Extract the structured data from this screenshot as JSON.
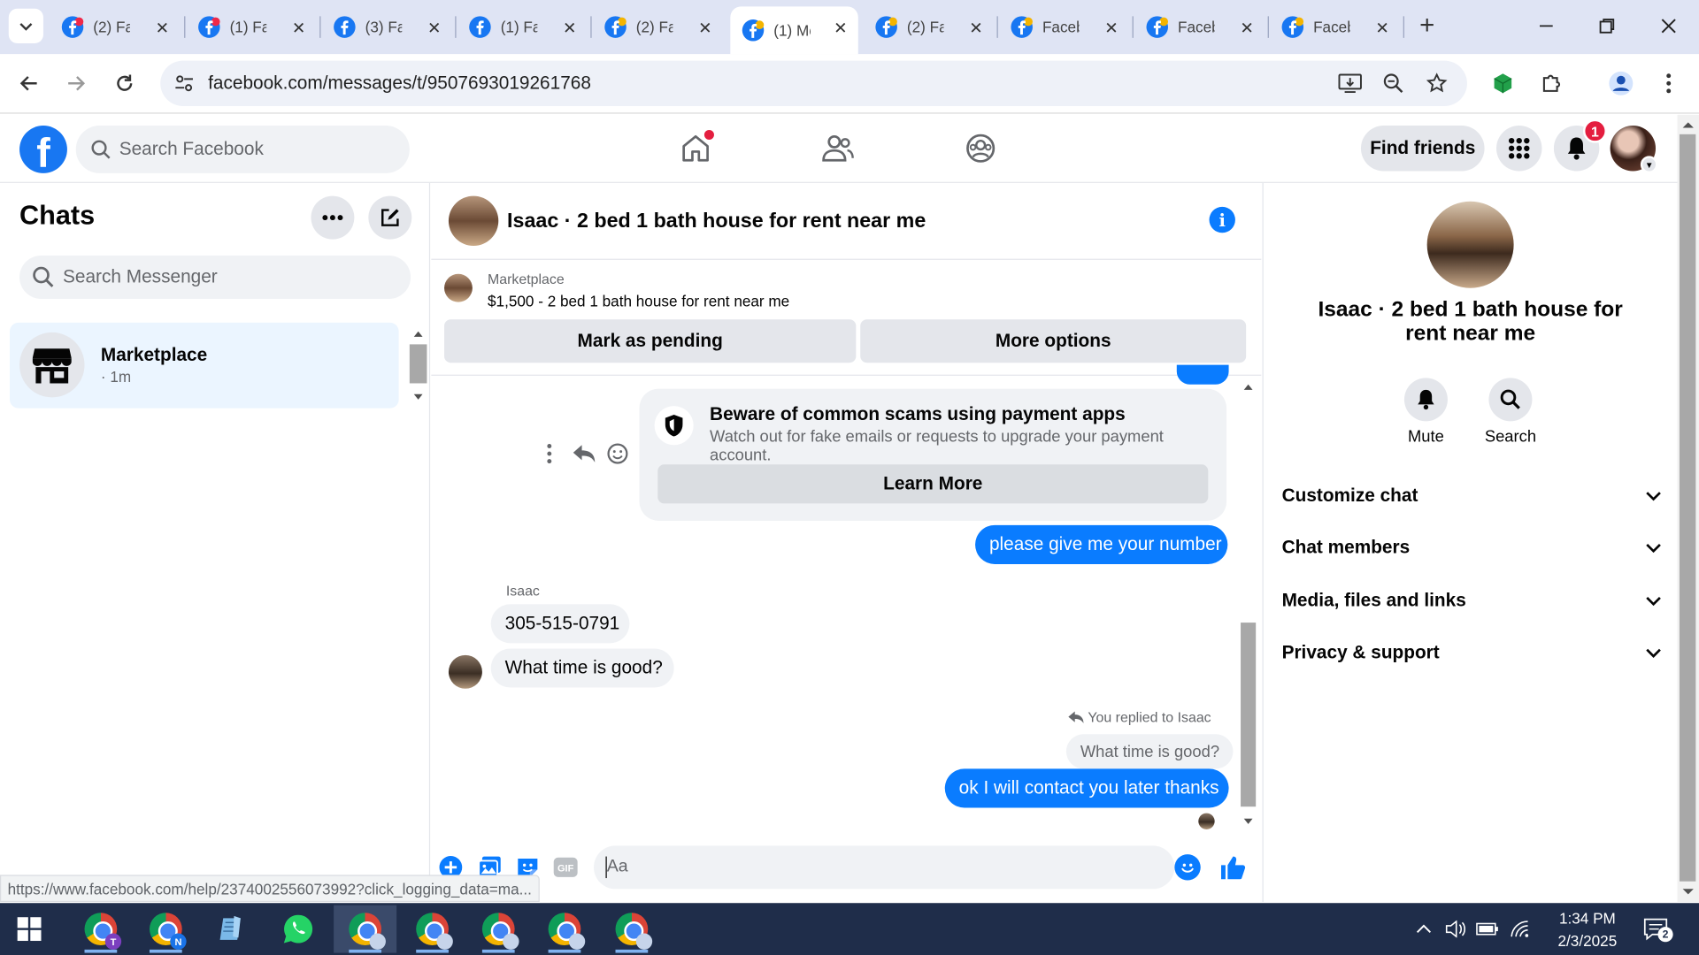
{
  "browser": {
    "tabs": [
      {
        "title": "(2) Fa",
        "favicon": "facebook-icon-color"
      },
      {
        "title": "(1) Fa",
        "favicon": "facebook-icon-color"
      },
      {
        "title": "(3) Fa",
        "favicon": "facebook-icon-blue"
      },
      {
        "title": "(1) Fa",
        "favicon": "facebook-icon-blue"
      },
      {
        "title": "(2) Fa",
        "favicon": "facebook-icon-color"
      },
      {
        "title": "(1) Me",
        "favicon": "facebook-icon-color",
        "active": true
      },
      {
        "title": "(2) Fa",
        "favicon": "facebook-icon-color"
      },
      {
        "title": "Faceb",
        "favicon": "facebook-icon-color"
      },
      {
        "title": "Faceb",
        "favicon": "facebook-icon-color"
      },
      {
        "title": "Faceb",
        "favicon": "facebook-icon-color"
      }
    ],
    "url": "facebook.com/messages/t/9507693019261768",
    "status_url": "https://www.facebook.com/help/2374002556073992?click_logging_data=ma..."
  },
  "fb_header": {
    "logo": "f",
    "search_placeholder": "Search Facebook",
    "find_friends": "Find friends",
    "notification_count": "1"
  },
  "chats": {
    "title": "Chats",
    "search_placeholder": "Search Messenger",
    "items": [
      {
        "name": "Marketplace",
        "time": "· 1m"
      }
    ]
  },
  "conversation": {
    "title": "Isaac · 2 bed 1 bath house for rent near me",
    "listing": {
      "source": "Marketplace",
      "price_title": "$1,500 - 2 bed 1 bath house for rent near me",
      "mark_pending": "Mark as pending",
      "more_options": "More options"
    },
    "scam_notice": {
      "title": "Beware of common scams using payment apps",
      "body": "Watch out for fake emails or requests to upgrade your payment account.",
      "button": "Learn More"
    },
    "messages": {
      "out_1": "please give me your number",
      "sender": "Isaac",
      "in_1": "305-515-0791",
      "in_2": "What time is good?",
      "replied_label": "You replied to Isaac",
      "quoted": "What time is good?",
      "out_2": "ok I will contact you later thanks"
    },
    "composer_placeholder": "Aa"
  },
  "info_panel": {
    "name": "Isaac · 2 bed 1 bath house for rent near me",
    "actions": [
      {
        "label": "Mute",
        "icon": "bell-icon"
      },
      {
        "label": "Search",
        "icon": "search-icon"
      }
    ],
    "sections": [
      "Customize chat",
      "Chat members",
      "Media, files and links",
      "Privacy & support"
    ]
  },
  "taskbar": {
    "time": "1:34 PM",
    "date": "2/3/2025",
    "notification_count": "2",
    "apps": [
      {
        "name": "chrome-t",
        "badge": "T",
        "badge_color": "#7b3fbf"
      },
      {
        "name": "chrome-n",
        "badge": "N",
        "badge_color": "#1a73e8"
      },
      {
        "name": "notepad"
      },
      {
        "name": "whatsapp"
      },
      {
        "name": "chrome-profile",
        "active": true
      },
      {
        "name": "chrome-profile-2"
      },
      {
        "name": "chrome-profile-3"
      },
      {
        "name": "chrome-profile-4"
      },
      {
        "name": "chrome-profile-5"
      }
    ]
  },
  "colors": {
    "fb_blue": "#1877f2",
    "messenger_blue": "#0a7cff",
    "alert_red": "#e41e3f",
    "taskbar": "#1f2d4a"
  }
}
